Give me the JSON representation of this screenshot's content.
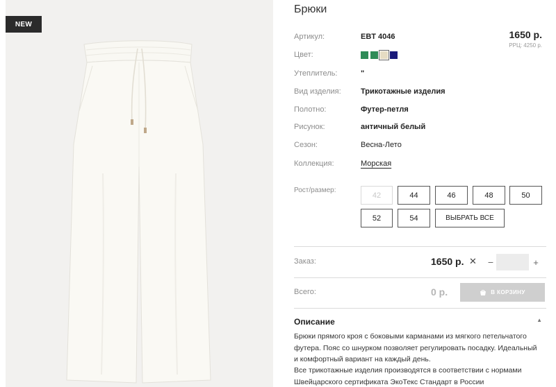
{
  "badge": {
    "new": "NEW"
  },
  "product": {
    "title": "Брюки",
    "price": "1650 р.",
    "rrp": "РРЦ: 4250 р."
  },
  "properties": {
    "article": {
      "label": "Артикул:",
      "value": "EBT 4046"
    },
    "color": {
      "label": "Цвет:"
    },
    "insulation": {
      "label": "Утеплитель:",
      "value": "\""
    },
    "type": {
      "label": "Вид изделия:",
      "value": "Трикотажные изделия"
    },
    "fabric": {
      "label": "Полотно:",
      "value": "Футер-петля"
    },
    "pattern": {
      "label": "Рисунок:",
      "value": "античный белый"
    },
    "season": {
      "label": "Сезон:",
      "value": "Весна-Лето"
    },
    "collection": {
      "label": "Коллекция:",
      "value": "Морская"
    }
  },
  "colors": [
    {
      "hex": "#2e8b57",
      "selected": false
    },
    {
      "hex": "#2e8b57",
      "selected": false
    },
    {
      "hex": "#e6dcc3",
      "selected": true
    },
    {
      "hex": "#1a1a7a",
      "selected": false
    }
  ],
  "sizes": {
    "label": "Рост/размер:",
    "items": [
      "42",
      "44",
      "46",
      "48",
      "50",
      "52",
      "54"
    ],
    "select_all": "ВЫБРАТЬ ВСЕ"
  },
  "order": {
    "label": "Заказ:",
    "price": "1650 р.",
    "times": "✕",
    "minus": "−",
    "plus": "+",
    "quantity": ""
  },
  "total": {
    "label": "Всего:",
    "value": "0 р.",
    "cart_button": "В КОРЗИНУ"
  },
  "description": {
    "title": "Описание",
    "toggle": "▲",
    "text1": "Брюки прямого кроя с боковыми карманами из мягкого петельчатого футера. Пояс со шнурком позволяет регулировать посадку. Идеальный и комфортный вариант на каждый день.",
    "text2": "Все трикотажные изделия производятся в соответствии с нормами Швейцарского сертификата ЭкоТекс Стандарт в России"
  },
  "icons": {
    "cart": "basket-icon",
    "times": "times-icon"
  },
  "theme": {
    "accent": "#2b2b2b",
    "muted_label": "#8c8c8c",
    "cart_disabled": "#cfcfcf",
    "image_bg": "#f2f1ef"
  }
}
